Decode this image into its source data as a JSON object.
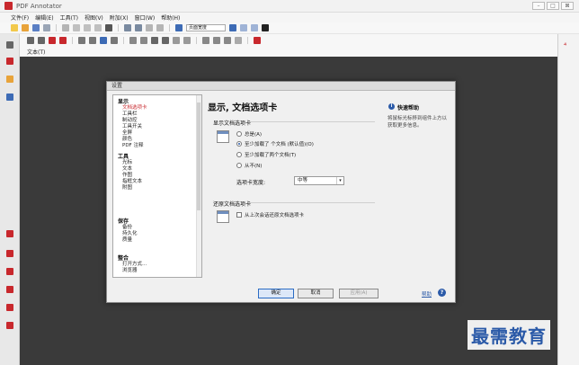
{
  "app": {
    "title": "PDF Annotator"
  },
  "window_controls": {
    "minimize": "–",
    "restore": "□",
    "close": "⊠"
  },
  "menu": [
    "文件(F)",
    "编辑(E)",
    "工具(T)",
    "视图(V)",
    "附加(X)",
    "窗口(W)",
    "帮助(H)"
  ],
  "toolbar": {
    "zoom_combo": "页面宽度"
  },
  "doc_tab": {
    "label": "文本(T)"
  },
  "dialog": {
    "title": "设置",
    "nav": [
      {
        "group": "显示",
        "items": [
          "文档选项卡",
          "工具栏",
          "制动控",
          "工具开关",
          "全屏",
          "颜色",
          "PDF 注释"
        ],
        "selected": 0
      },
      {
        "group": "工具",
        "items": [
          "光标",
          "文本",
          "作图",
          "指框文本",
          "附图"
        ]
      },
      {
        "group": "保存",
        "items": [
          "备份",
          "持久化",
          "质量"
        ]
      },
      {
        "group": "整合",
        "items": [
          "打开方式...",
          "浏览器"
        ]
      }
    ],
    "panel_title": "显示, 文档选项卡",
    "section_show_tabs": "显示文档选项卡",
    "radios": [
      {
        "label": "总是(A)",
        "checked": false
      },
      {
        "label": "至少加载了   个文档 (默认值)(O)",
        "checked": true
      },
      {
        "label": "至少加载了两个文档(T)",
        "checked": false
      },
      {
        "label": "从不(N)",
        "checked": false
      }
    ],
    "tab_width_label": "选项卡宽度:",
    "tab_width_value": "中等",
    "section_restore": "还原文档选项卡",
    "restore_checkbox": "从上次会话还原文档选项卡",
    "help": {
      "title": "快速帮助",
      "text": "将鼠标光标移到组件上方以获取更多信息。"
    },
    "buttons": {
      "ok": "确定",
      "cancel": "取消",
      "apply": "应用(A)",
      "help": "帮助"
    }
  },
  "watermark": "最需教育",
  "colors": {
    "accent_red": "#c8282d",
    "accent_blue": "#2b5aa8"
  }
}
